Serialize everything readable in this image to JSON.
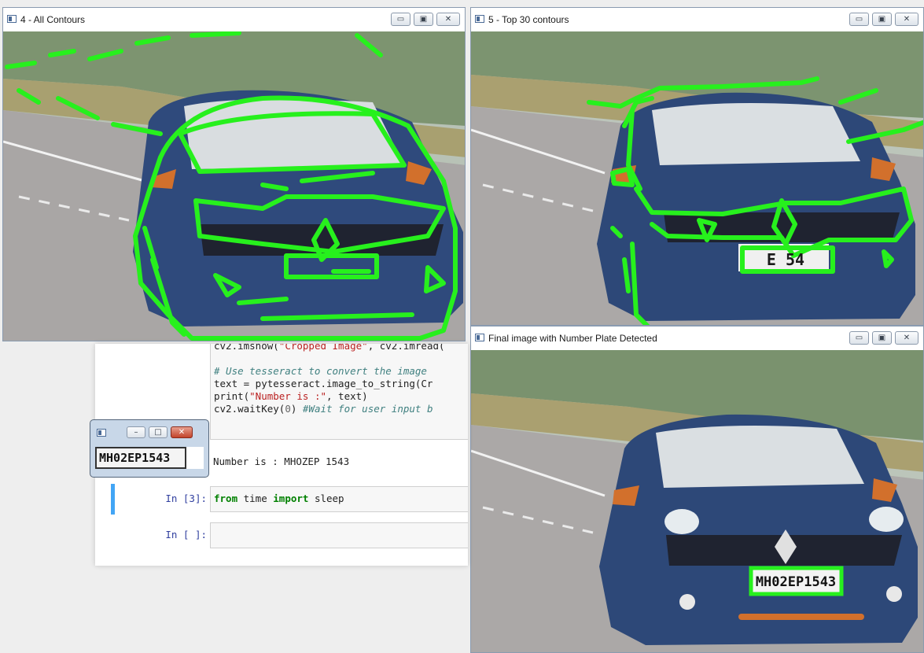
{
  "windows": {
    "all_contours": {
      "title": "4 - All Contours",
      "minimize": "▭",
      "maximize": "▣",
      "close": "✕"
    },
    "top_contours": {
      "title": "5 - Top 30 contours",
      "minimize": "▭",
      "maximize": "▣",
      "close": "✕"
    },
    "final_image": {
      "title": "Final image with Number Plate Detected",
      "minimize": "▭",
      "maximize": "▣",
      "close": "✕"
    },
    "plate_popup": {
      "minimize": "–",
      "maximize": "□",
      "close": "✕",
      "plate_text": "MH02EP1543"
    }
  },
  "images": {
    "top_plate_partial": "E 54",
    "final_plate_text": "MH02EP1543"
  },
  "notebook": {
    "code_lines": [
      {
        "indent": "",
        "parts": [
          {
            "t": "cv2.imshow(",
            "c": ""
          },
          {
            "t": "\"Cropped Image\"",
            "c": "str"
          },
          {
            "t": ", cv2.imread(",
            "c": ""
          }
        ]
      },
      {
        "indent": "",
        "parts": [
          {
            "t": "",
            "c": ""
          }
        ]
      },
      {
        "indent": "",
        "parts": [
          {
            "t": "# Use tesseract to convert the image",
            "c": "cm"
          }
        ]
      },
      {
        "indent": "",
        "parts": [
          {
            "t": "text = pytesseract.image_to_string(Cr",
            "c": ""
          }
        ]
      },
      {
        "indent": "",
        "parts": [
          {
            "t": "print(",
            "c": ""
          },
          {
            "t": "\"Number is :\"",
            "c": "str"
          },
          {
            "t": ", text)",
            "c": ""
          }
        ]
      },
      {
        "indent": "",
        "parts": [
          {
            "t": "cv2.waitKey(",
            "c": ""
          },
          {
            "t": "0",
            "c": "num"
          },
          {
            "t": ") ",
            "c": ""
          },
          {
            "t": "#Wait for user input b",
            "c": "cm"
          }
        ]
      }
    ],
    "output_text": "Number is : MHOZEP 1543",
    "cell3_prompt": "In [3]:",
    "cell3_code_kw1": "from",
    "cell3_code_mid": " time ",
    "cell3_code_kw2": "import",
    "cell3_code_end": " sleep",
    "cell_empty_prompt": "In [ ]:"
  }
}
